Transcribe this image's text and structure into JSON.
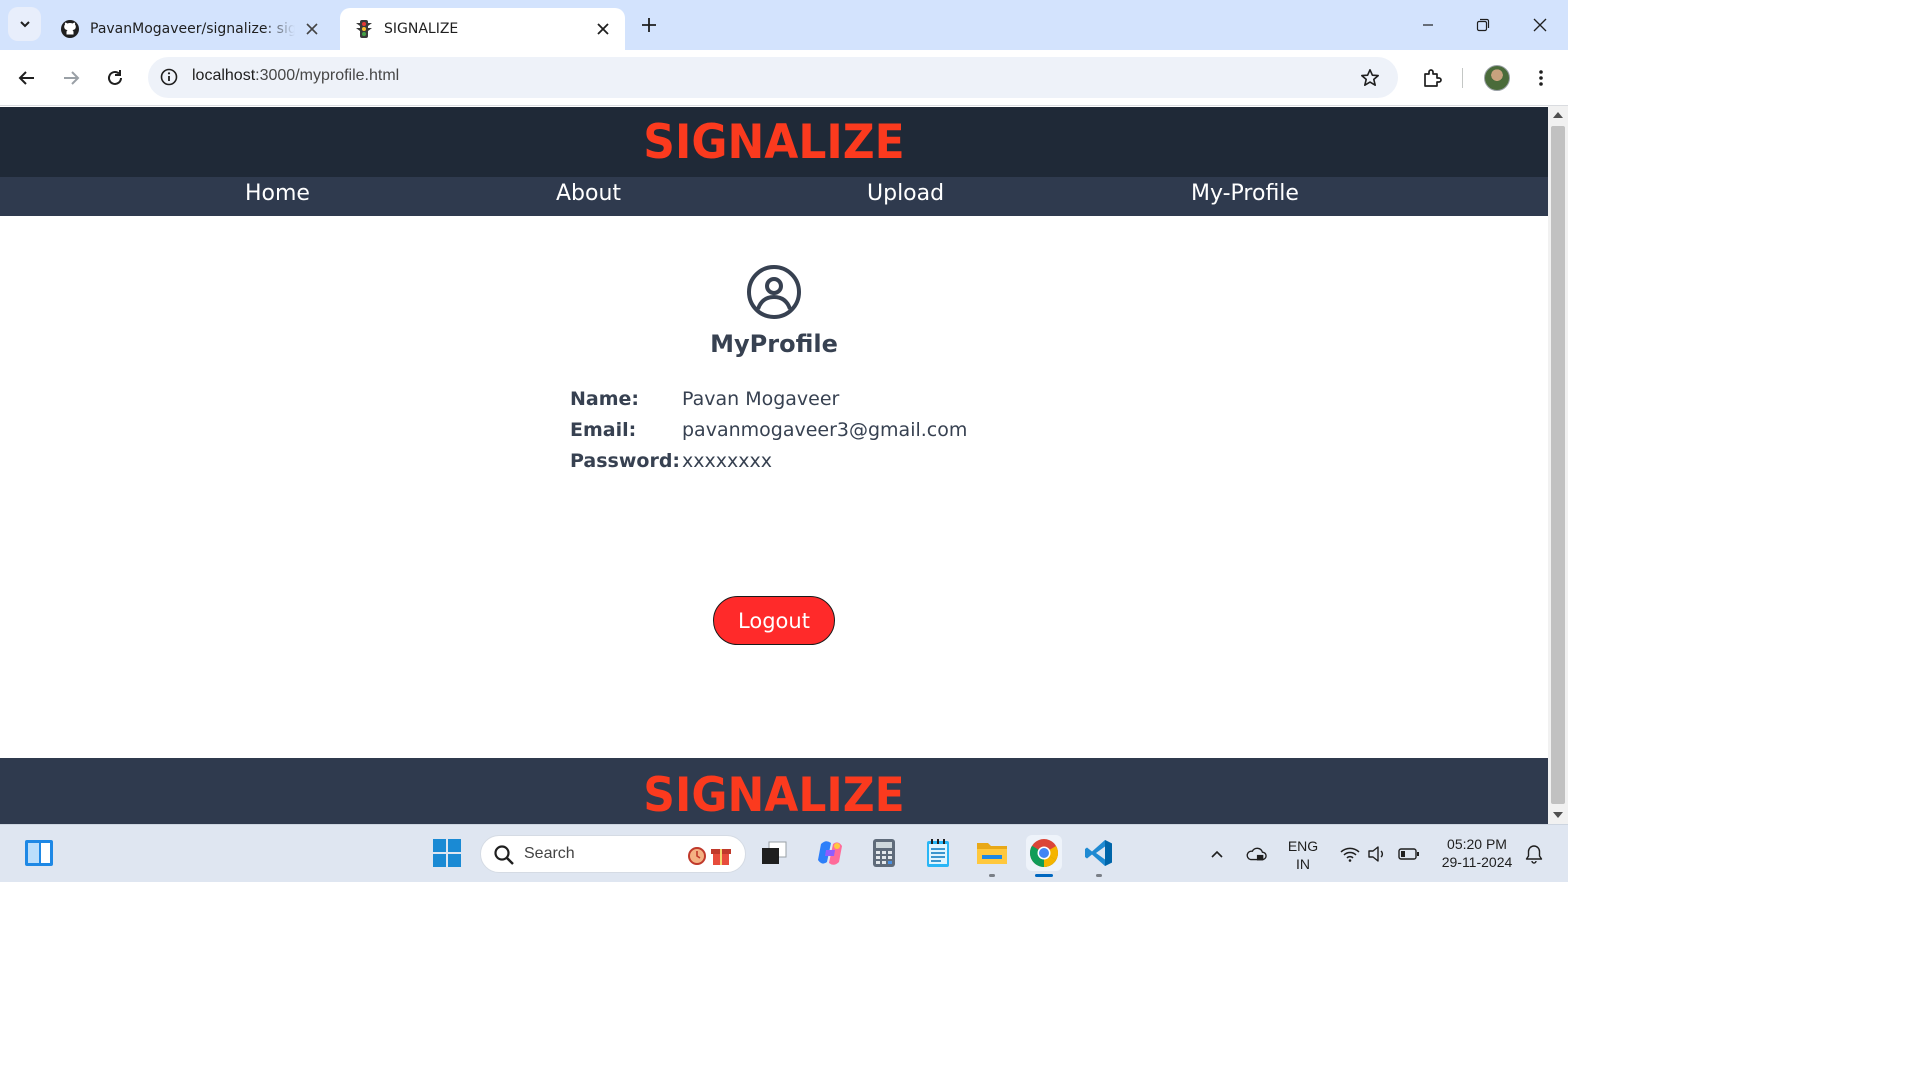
{
  "browser": {
    "tabs": [
      {
        "title": "PavanMogaveer/signalize: signa",
        "favicon": "github-icon",
        "active": false
      },
      {
        "title": "SIGNALIZE",
        "favicon": "traffic-light-icon",
        "active": true
      }
    ],
    "address": {
      "host": "localhost",
      "path": ":3000/myprofile.html"
    }
  },
  "site": {
    "brand": "SIGNALIZE",
    "brand_color": "#fb3a1e",
    "header_color": "#1f2937",
    "nav_color": "#2f3a4e",
    "nav": [
      "Home",
      "About",
      "Upload",
      "My-Profile"
    ],
    "footer_brand": "SIGNALIZE"
  },
  "profile": {
    "icon": "user-circle-icon",
    "heading": "MyProfile",
    "fields": [
      {
        "label": "Name:",
        "value": "Pavan Mogaveer"
      },
      {
        "label": "Email:",
        "value": "pavanmogaveer3@gmail.com"
      },
      {
        "label": "Password:",
        "value": "xxxxxxxx"
      }
    ],
    "logout_label": "Logout",
    "logout_color": "#ff2a2a"
  },
  "taskbar": {
    "search_placeholder": "Search",
    "language_line1": "ENG",
    "language_line2": "IN",
    "time": "05:20 PM",
    "date": "29-11-2024"
  }
}
